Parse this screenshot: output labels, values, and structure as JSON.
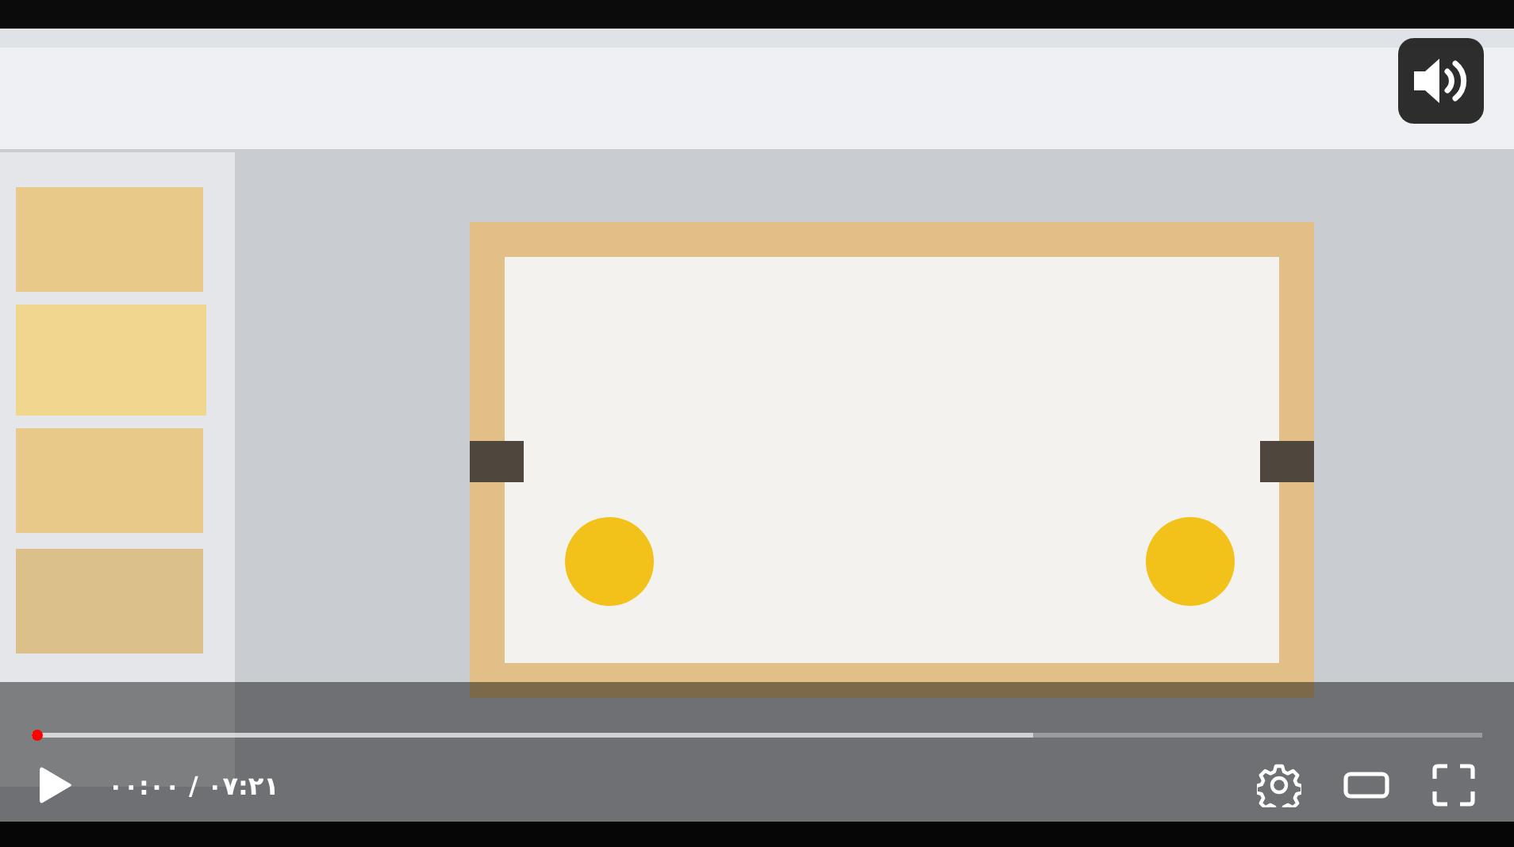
{
  "player": {
    "muted": false,
    "playing": false,
    "time": "۰۰:۰۰ / ۰۷:۲۱"
  },
  "progress_bar": {
    "level": 0
  },
  "buffer_bar": {
    "level": 0.69
  }
}
